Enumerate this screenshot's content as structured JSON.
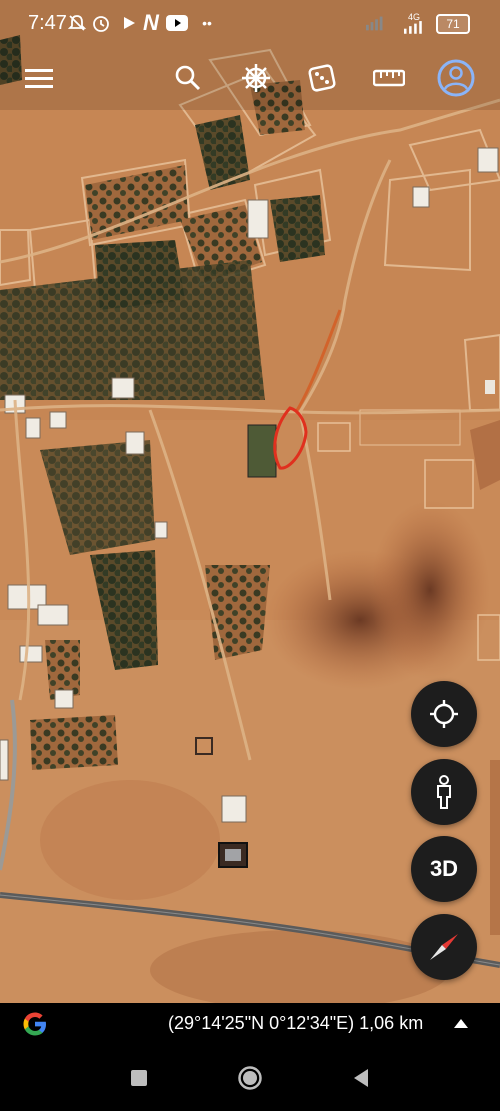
{
  "status_bar": {
    "time": "7:47",
    "icons": [
      "mute-icon",
      "alarm-icon",
      "play-icon",
      "netflix-icon",
      "youtube-icon",
      "more-dots-icon"
    ],
    "network": "4G",
    "battery": "71"
  },
  "toolbar": {
    "items": [
      "menu-icon",
      "search-icon",
      "voyager-wheel-icon",
      "dice-icon",
      "ruler-icon",
      "account-icon"
    ]
  },
  "map": {
    "type": "satellite",
    "annotation_color": "#e0301e",
    "road_color": "#5b5b5b"
  },
  "fabs": {
    "locate": "crosshair-icon",
    "pegman": "pegman-icon",
    "three_d_label": "3D",
    "compass": "compass-icon"
  },
  "info_bar": {
    "logo": "google-logo",
    "coordinates": "(29°14'25\"N 0°12'34\"E) 1,06 km",
    "expand": "chevron-up-icon"
  },
  "nav_bar": {
    "items": [
      "recents-icon",
      "home-icon",
      "back-icon"
    ]
  }
}
